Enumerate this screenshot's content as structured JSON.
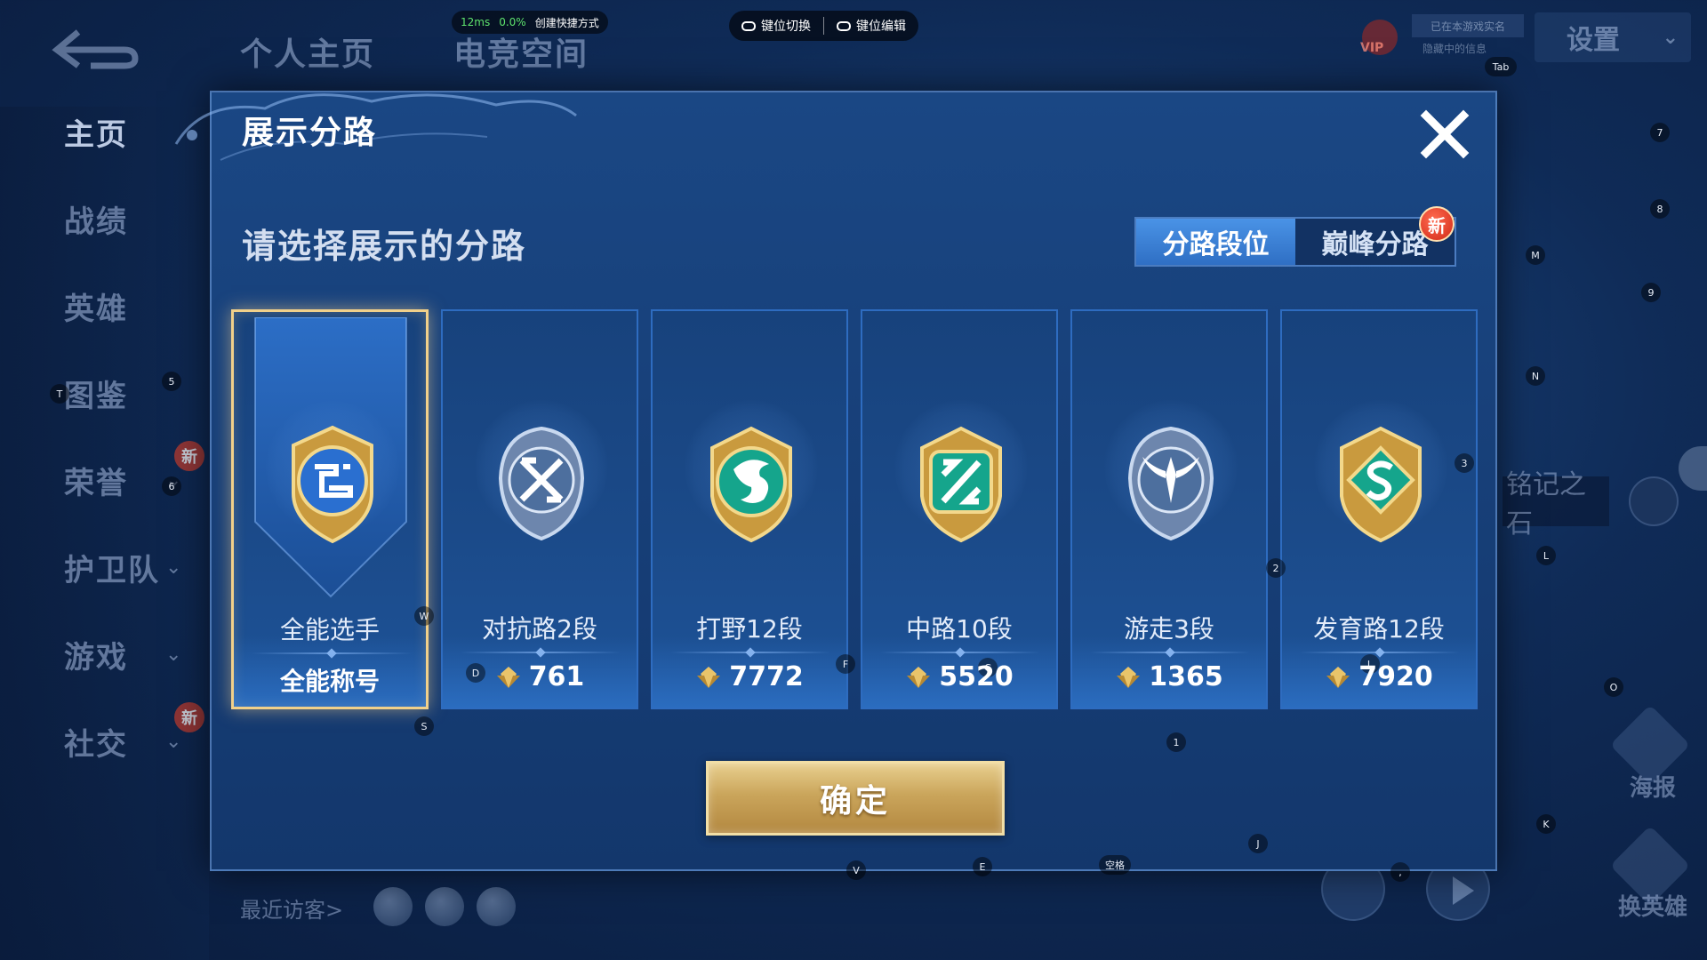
{
  "background": {
    "tabs": [
      "个人主页",
      "电竞空间"
    ],
    "sidebar": [
      {
        "label": "主页",
        "active": true,
        "chevron": false,
        "badge": ""
      },
      {
        "label": "战绩",
        "active": false,
        "chevron": false,
        "badge": ""
      },
      {
        "label": "英雄",
        "active": false,
        "chevron": false,
        "badge": ""
      },
      {
        "label": "图鉴",
        "active": false,
        "chevron": false,
        "badge": ""
      },
      {
        "label": "荣誉",
        "active": false,
        "chevron": true,
        "badge": "新"
      },
      {
        "label": "护卫队",
        "active": false,
        "chevron": true,
        "badge": ""
      },
      {
        "label": "游戏",
        "active": false,
        "chevron": true,
        "badge": ""
      },
      {
        "label": "社交",
        "active": false,
        "chevron": true,
        "badge": "新"
      }
    ],
    "chevron_glyph": "⌄",
    "recent_visitors": "最近访客>",
    "settings": "设置",
    "vip": "VIP",
    "notice": "已在本游戏实名",
    "notice2": "隐藏中的信息",
    "side_stone": "铭记之石",
    "poster": "海报",
    "swap_hero": "换英雄"
  },
  "hud": {
    "ping": "12ms",
    "loss": "0.0%",
    "create_shortcut": "创建快捷方式",
    "key_switch": "键位切换",
    "key_edit": "键位编辑",
    "key_hints": [
      "Tab",
      "7",
      "8",
      "M",
      "9",
      "N",
      "5",
      "T",
      "6",
      "W",
      "D",
      "F",
      "C",
      "L",
      "2",
      "3",
      "L",
      "O",
      "S",
      "1",
      "K",
      "J",
      "V",
      "E",
      "空格",
      ","
    ]
  },
  "modal": {
    "title": "展示分路",
    "subtitle": "请选择展示的分路",
    "toggle": {
      "left": "分路段位",
      "right": "巅峰分路",
      "new_badge": "新"
    },
    "confirm": "确定",
    "accent_gold": "#f1d08a",
    "cards": [
      {
        "name": "全能选手",
        "title": "全能称号",
        "score": "",
        "selected": true,
        "icon": "all-round-emblem-icon",
        "color": "#3b7fe0"
      },
      {
        "name": "对抗路2段",
        "title": "",
        "score": "761",
        "selected": false,
        "icon": "clash-lane-emblem-icon",
        "color": "#8fb0de"
      },
      {
        "name": "打野12段",
        "title": "",
        "score": "7772",
        "selected": false,
        "icon": "jungle-emblem-icon",
        "color": "#22b79e"
      },
      {
        "name": "中路10段",
        "title": "",
        "score": "5520",
        "selected": false,
        "icon": "mid-lane-emblem-icon",
        "color": "#22b79e"
      },
      {
        "name": "游走3段",
        "title": "",
        "score": "1365",
        "selected": false,
        "icon": "roam-emblem-icon",
        "color": "#8fb0de"
      },
      {
        "name": "发育路12段",
        "title": "",
        "score": "7920",
        "selected": false,
        "icon": "farm-lane-emblem-icon",
        "color": "#22b79e"
      }
    ]
  }
}
